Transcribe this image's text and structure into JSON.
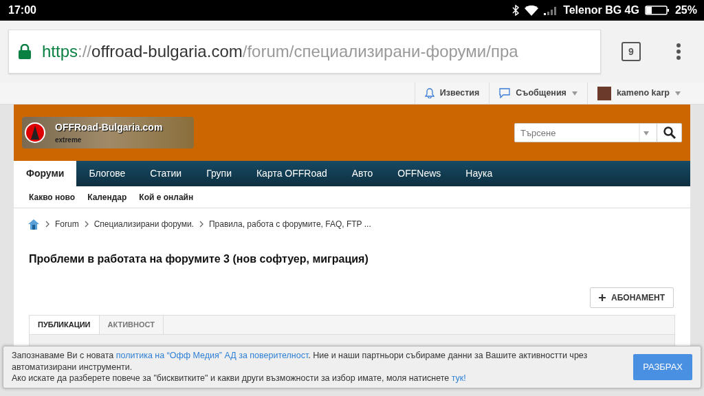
{
  "status_bar": {
    "time": "17:00",
    "carrier": "Telenor BG 4G",
    "battery": "25%"
  },
  "address_bar": {
    "scheme": "https",
    "separator": "://",
    "host": "offroad-bulgaria.com",
    "path": "/forum/специализирани-форуми/пра",
    "secure": true
  },
  "tab_count": "9",
  "user_bar": [
    {
      "kind": "bell",
      "label": "Известия",
      "dropdown": false
    },
    {
      "kind": "messages",
      "label": "Съобщения",
      "dropdown": true
    },
    {
      "kind": "user",
      "label": "kameno karp",
      "dropdown": true
    }
  ],
  "logo": {
    "title": "OFFRoad-Bulgaria.com",
    "tagline": "extreme"
  },
  "search": {
    "placeholder": "Търсене"
  },
  "nav_tabs": [
    {
      "label": "Форуми",
      "selected": true
    },
    {
      "label": "Блогове",
      "selected": false
    },
    {
      "label": "Статии",
      "selected": false
    },
    {
      "label": "Групи",
      "selected": false
    },
    {
      "label": "Карта OFFRoad",
      "selected": false
    },
    {
      "label": "Авто",
      "selected": false
    },
    {
      "label": "OFFNews",
      "selected": false
    },
    {
      "label": "Наука",
      "selected": false
    }
  ],
  "sub_nav": [
    "Какво ново",
    "Календар",
    "Кой е онлайн"
  ],
  "breadcrumbs": [
    "Forum",
    "Специализирани форуми.",
    "Правила, работа с форумите, FAQ, FTP ..."
  ],
  "thread_title": "Проблеми в работата на форумите 3 (нов софтуер, миграция)",
  "subscribe_button": "АБОНАМЕНТ",
  "content_tabs": [
    {
      "label": "ПУБЛИКАЦИИ",
      "selected": true
    },
    {
      "label": "АКТИВНОСТ",
      "selected": false
    }
  ],
  "cookie_banner": {
    "paragraphs": [
      {
        "before": "Запознаваме Ви с новата ",
        "link": "политика на “Офф Медия” АД за поверителност",
        "after": ". Ние и наши партньори събираме данни за Вашите активностти чрез автоматизирани инструменти."
      },
      {
        "before": "Ако искате да разберете повече за \"бисквитките\" и какви други възможности за избор имате, моля натиснете ",
        "link": "тук!"
      }
    ],
    "button": "РАЗБРАХ"
  }
}
